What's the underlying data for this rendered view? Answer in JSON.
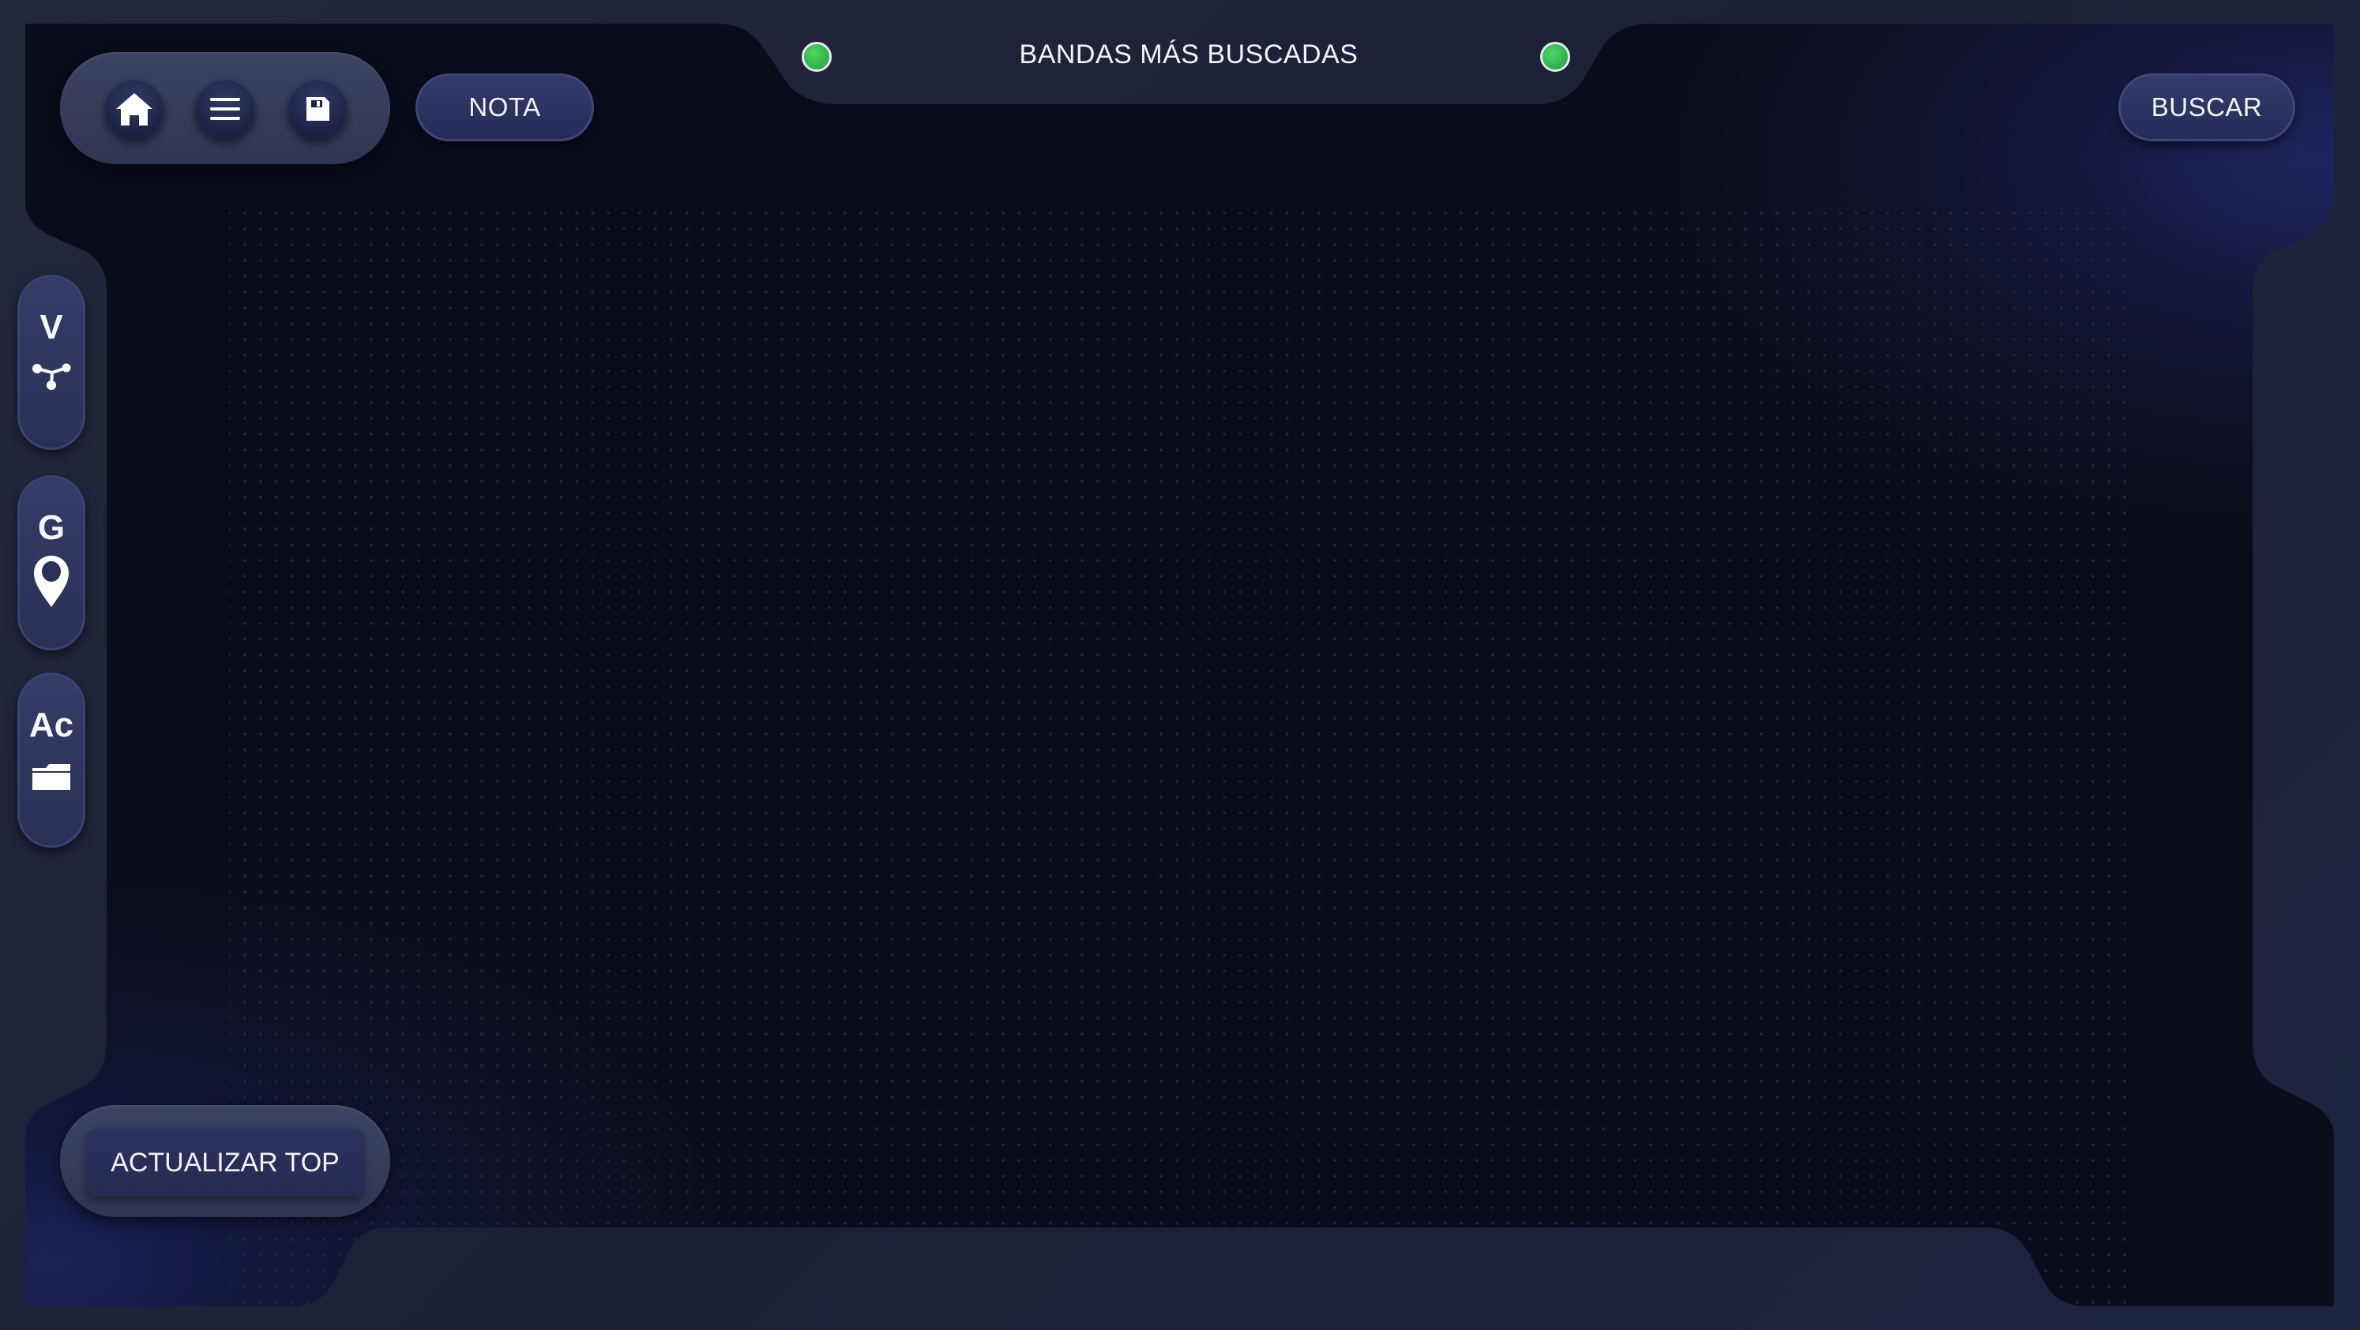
{
  "header": {
    "title": "BANDAS MÁS BUSCADAS",
    "indicator_color": "#34b34f"
  },
  "toolbar": {
    "icons": [
      "home-icon",
      "menu-icon",
      "save-icon"
    ],
    "nota_label": "NOTA"
  },
  "search": {
    "label": "BUSCAR"
  },
  "side_tabs": [
    {
      "letter": "V",
      "icon": "network-icon"
    },
    {
      "letter": "G",
      "icon": "location-pin-icon"
    },
    {
      "letter": "Ac",
      "icon": "folder-icon"
    }
  ],
  "footer": {
    "update_label": "ACTUALIZAR TOP"
  },
  "colors": {
    "screen_background": "#0b0d1c",
    "frame": "#1f2437",
    "button": "#2c3260",
    "accent_glow": "#24296a"
  }
}
